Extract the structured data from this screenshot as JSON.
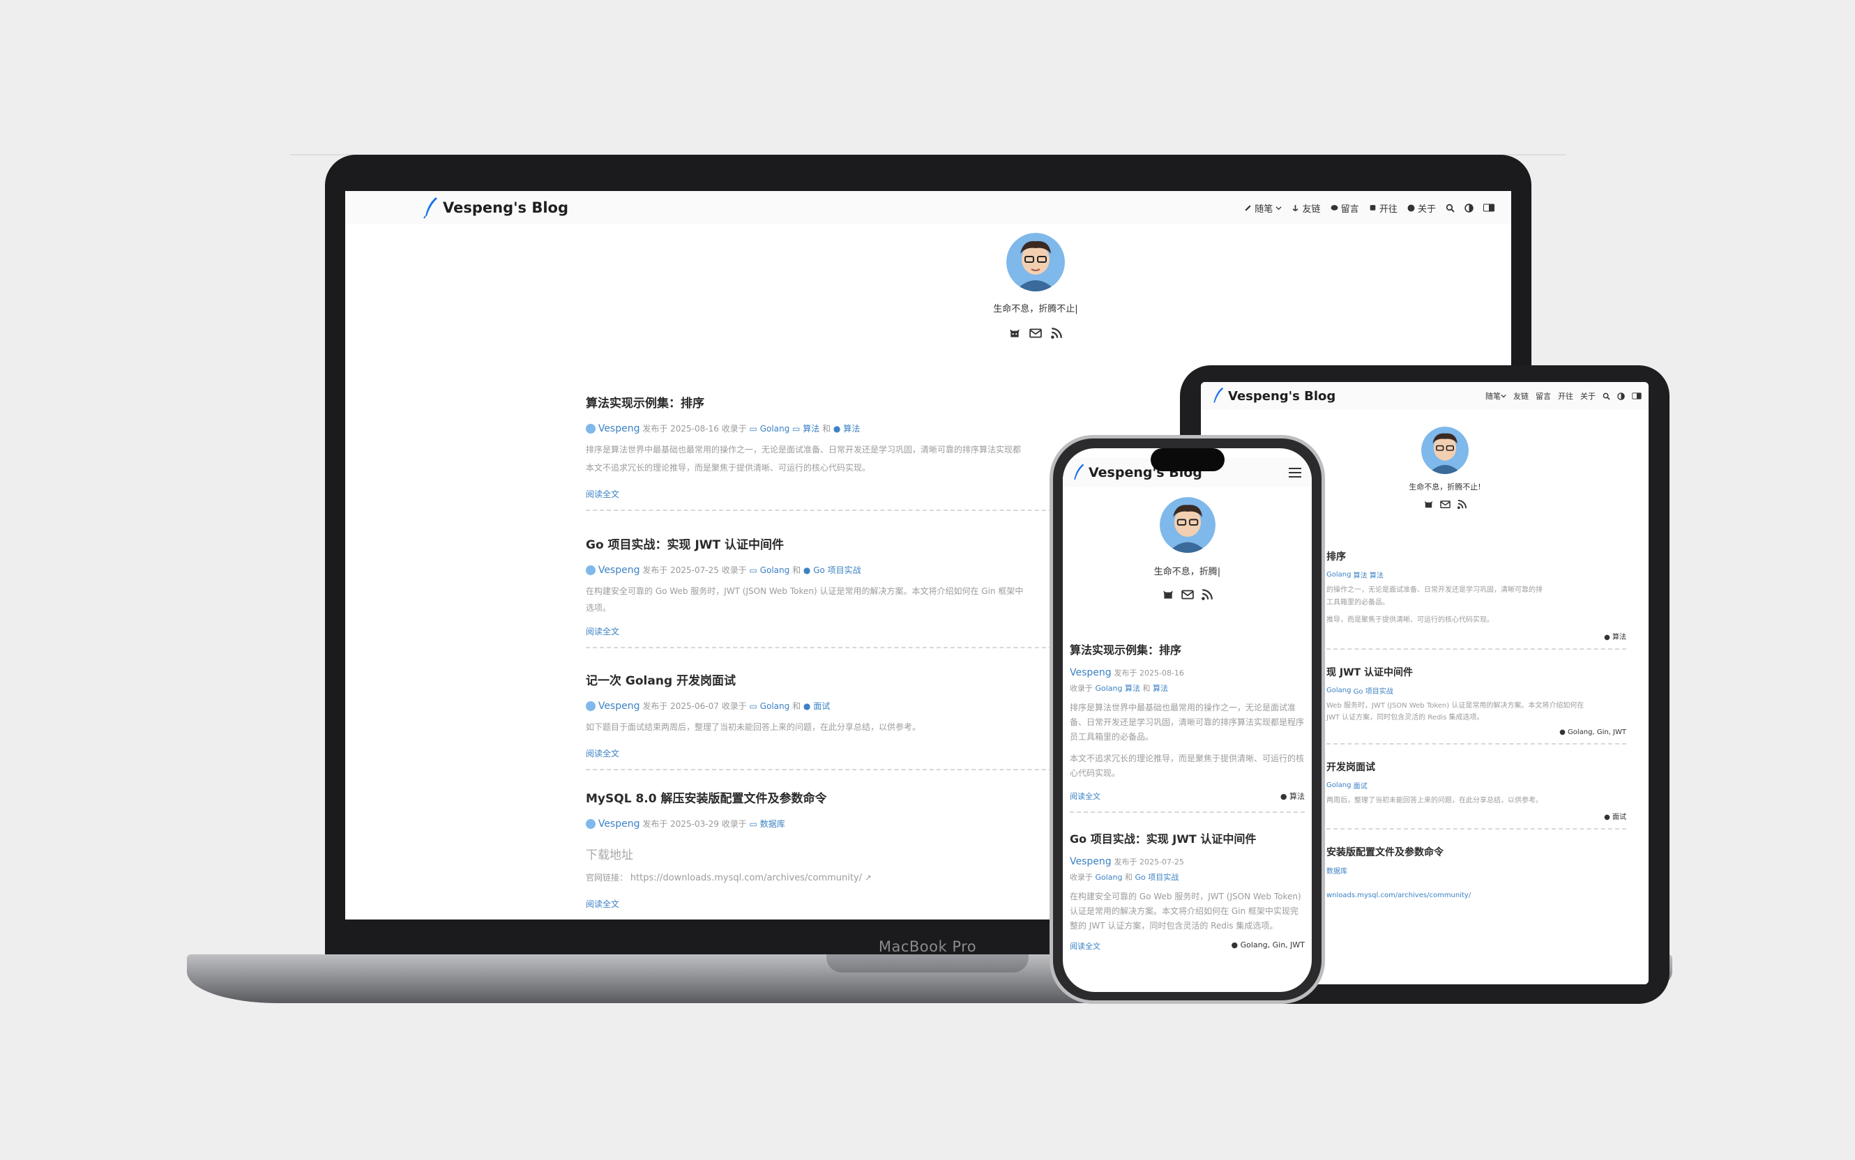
{
  "blog": {
    "title": "Vespeng's Blog",
    "nav": {
      "essay": "随笔",
      "links": "友链",
      "message": "留言",
      "open": "开往",
      "about": "关于"
    },
    "motto_laptop": "生命不息，折腾不止|",
    "motto_tablet": "生命不息，折腾不止!",
    "motto_phone": "生命不息，折腾|",
    "read_more": "阅读全文"
  },
  "device": {
    "laptop_brand": "MacBook Pro"
  },
  "posts": [
    {
      "title": "算法实现示例集：排序",
      "author": "Vespeng",
      "date_prefix": "发布于 2025-08-16 收录于",
      "date_phone": "发布于 2025-08-16",
      "phone_collect": "收录于",
      "cat1": "Golang",
      "cat2": "算法",
      "and": "和",
      "series": "算法",
      "excerpt_laptop": "排序是算法世界中最基础也最常用的操作之一，无论是面试准备、日常开发还是学习巩固，清晰可靠的排序算法实现都",
      "excerpt2": "本文不追求冗长的理论推导，而是聚焦于提供清晰、可运行的核心代码实现。",
      "excerpt_phone1": "排序是算法世界中最基础也最常用的操作之一，无论是面试准备、日常开发还是学习巩固，清晰可靠的排序算法实现都是程序员工具箱里的必备品。",
      "excerpt_phone2": "本文不追求冗长的理论推导，而是聚焦于提供清晰、可运行的核心代码实现。",
      "tag": "算法"
    },
    {
      "title": "Go 项目实战：实现 JWT 认证中间件",
      "author": "Vespeng",
      "date_prefix": "发布于 2025-07-25 收录于",
      "date_phone": "发布于 2025-07-25",
      "cat1": "Golang",
      "and": "和",
      "series": "Go 项目实战",
      "excerpt_laptop": "在构建安全可靠的 Go Web 服务时，JWT (JSON Web Token) 认证是常用的解决方案。本文将介绍如何在 Gin 框架中",
      "excerpt_laptop2": "选项。",
      "excerpt_phone": "在构建安全可靠的 Go Web 服务时，JWT (JSON Web Token) 认证是常用的解决方案。本文将介绍如何在 Gin 框架中实现完整的 JWT 认证方案，同时包含灵活的 Redis 集成选项。",
      "tag": "Golang, Gin, JWT"
    },
    {
      "title": "记一次 Golang 开发岗面试",
      "author": "Vespeng",
      "date_prefix": "发布于 2025-06-07 收录于",
      "cat1": "Golang",
      "and": "和",
      "series": "面试",
      "excerpt_laptop": "如下题目于面试结束两周后，整理了当初未能回答上来的问题，在此分享总结，以供参考。",
      "tag": "面试"
    },
    {
      "title": "MySQL 8.0 解压安装版配置文件及参数命令",
      "author": "Vespeng",
      "date_prefix": "发布于 2025-03-29 收录于",
      "cat1": "数据库",
      "heading": "下载地址",
      "link_label": "官网链接：",
      "link": "https://downloads.mysql.com/archives/community/",
      "link_tablet": "wnloads.mysql.com/archives/community/"
    }
  ],
  "tablet_fragments": {
    "t1": "排序",
    "t2": "现 JWT 认证中间件",
    "t3": "开发岗面试",
    "t4": "安装版配置文件及参数命令",
    "ex1a": "的操作之一，无论是面试准备、日常开发还是学习巩固，清晰可靠的排",
    "ex1b": "工具箱里的必备品。",
    "ex1c": "推导，而是聚焦于提供清晰、可运行的核心代码实现。",
    "ex2a": "Web 服务时，JWT (JSON Web Token) 认证是常用的解决方案。本文将介绍如何在",
    "ex2b": "JWT 认证方案，同时包含灵活的 Redis 集成选项。",
    "ex3": "两周后，整理了当初未能回答上来的问题，在此分享总结，以供参考。",
    "more": "阅读全文"
  },
  "colors": {
    "link": "#3b82c4",
    "accent_blue": "#1a73e8"
  }
}
